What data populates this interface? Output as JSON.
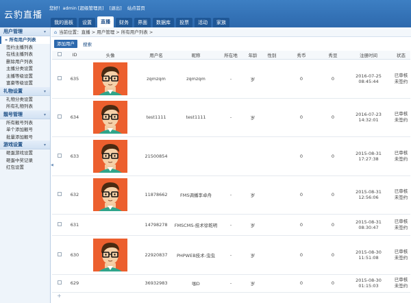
{
  "app": {
    "title": "云豹直播"
  },
  "topbar": {
    "greeting": "您好！admin [超级管理员]",
    "logout": "[退出]",
    "site_home": "站点首页"
  },
  "nav_tabs": [
    "我的面板",
    "设置",
    "直播",
    "财务",
    "界面",
    "数据库",
    "投票",
    "活动",
    "家族"
  ],
  "active_tab": "直播",
  "sidebar": {
    "sections": [
      {
        "title": "用户管理",
        "items": [
          "» 所有用户列表",
          "签约主播列表",
          "在线主播列表",
          "删除用户列表",
          "主播分类设置",
          "主播等级设置",
          "富豪等级设置"
        ]
      },
      {
        "title": "礼物设置",
        "items": [
          "礼物分类设置",
          "所有礼物列表"
        ]
      },
      {
        "title": "靓号管理",
        "items": [
          "所有靓号列表",
          "单个添加靓号",
          "批量添加靓号"
        ]
      },
      {
        "title": "游戏设置",
        "items": [
          "砸蛋游戏设置",
          "砸蛋中奖记录",
          "红包设置"
        ]
      }
    ]
  },
  "breadcrumb": "当前位置：直播 > 用户管理 > 所有用户列表 >",
  "toolbar": {
    "add_user": "添加用户",
    "search": "搜索"
  },
  "table": {
    "headers": [
      "",
      "ID",
      "头像",
      "用户名",
      "昵称",
      "所在地",
      "年龄",
      "性别",
      "秀币",
      "秀豆",
      "注册时间",
      "状态"
    ],
    "rows": [
      {
        "id": "635",
        "has_avatar": true,
        "username": "zqmzqm",
        "nickname": "zqmzqm",
        "location": "-",
        "age": "岁",
        "gender": "",
        "coins": "0",
        "beans": "0",
        "registered": "2016-07-25 08:45:44",
        "status": [
          "已审核",
          "未签约"
        ]
      },
      {
        "id": "634",
        "has_avatar": true,
        "username": "test1111",
        "nickname": "test1111",
        "location": "-",
        "age": "岁",
        "gender": "",
        "coins": "0",
        "beans": "0",
        "registered": "2016-07-23 14:32:01",
        "status": [
          "已审核",
          "未签约"
        ]
      },
      {
        "id": "633",
        "has_avatar": true,
        "username": "21500854",
        "nickname": "",
        "location": "",
        "age": "",
        "gender": "",
        "coins": "0",
        "beans": "0",
        "registered": "2015-08-31 17:27:38",
        "status": [
          "已审核",
          "未签约"
        ]
      },
      {
        "id": "632",
        "has_avatar": true,
        "username": "11878662",
        "nickname": "FMS调播李卓舟",
        "location": "-",
        "age": "岁",
        "gender": "",
        "coins": "0",
        "beans": "0",
        "registered": "2015-08-31 12:56:06",
        "status": [
          "已审核",
          "未签约"
        ]
      },
      {
        "id": "631",
        "has_avatar": false,
        "username": "14798278",
        "nickname": "FMSCMS-技术徐乾明",
        "location": "-",
        "age": "岁",
        "gender": "",
        "coins": "0",
        "beans": "0",
        "registered": "2015-08-31 08:30:47",
        "status": [
          "已审核",
          "未签约"
        ]
      },
      {
        "id": "630",
        "has_avatar": true,
        "username": "22920837",
        "nickname": "PHPWEB技术-虫虫",
        "location": "-",
        "age": "岁",
        "gender": "",
        "coins": "0",
        "beans": "0",
        "registered": "2015-08-30 11:51:08",
        "status": [
          "已审核",
          "未签约"
        ]
      },
      {
        "id": "629",
        "has_avatar": false,
        "username": "36932983",
        "nickname": "咖D",
        "location": "-",
        "age": "岁",
        "gender": "",
        "coins": "0",
        "beans": "0",
        "registered": "2015-08-30 01:15:03",
        "status": [
          "已审核",
          "未签约"
        ]
      }
    ],
    "footer_symbol": "+"
  },
  "colors": {
    "header": "#2d69ad",
    "avatar_bg": "#ec5f2e",
    "sidebar_bg": "#eef4fa"
  }
}
